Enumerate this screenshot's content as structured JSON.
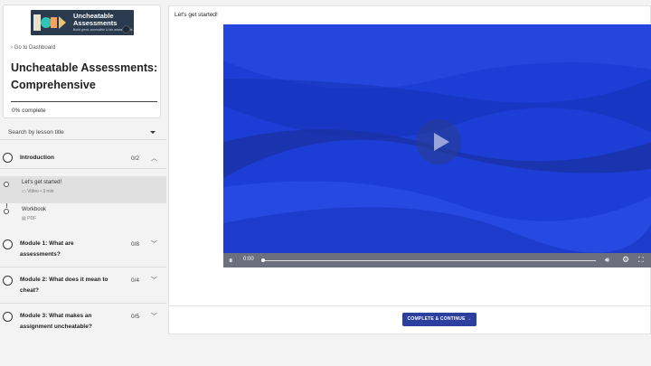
{
  "banner": {
    "title_line1": "Uncheatable",
    "title_line2": "Assessments",
    "subtitle": "Build great, accessible & fair assessments",
    "colors": {
      "bg": "#2a3a4f"
    }
  },
  "sidebar": {
    "back_label": "Go to Dashboard",
    "back_icon": "chevron-left-icon",
    "course_title": "Uncheatable Assessments: Comprehensive",
    "progress_text": "0% complete",
    "search_placeholder": "Search by lesson title",
    "sections": [
      {
        "title": "Introduction",
        "count": "0/2",
        "expanded": true,
        "lessons": [
          {
            "title": "Let's get started!",
            "meta": "Video • 3 min",
            "icon": "video-icon",
            "active": true
          },
          {
            "title": "Workbook",
            "meta": "PDF",
            "icon": "pdf-icon",
            "active": false
          }
        ]
      },
      {
        "title": "Module 1: What are assessments?",
        "title_line1": "Module 1: What are",
        "title_line2": "assessments?",
        "count": "0/8",
        "expanded": false
      },
      {
        "title": "Module 2: What does it mean to cheat?",
        "title_line1": "Module 2: What does it mean to",
        "title_line2": "cheat?",
        "count": "0/4",
        "expanded": false
      },
      {
        "title": "Module 3: What makes an assignment uncheatable?",
        "title_line1": "Module 3: What makes an",
        "title_line2": "assignment uncheatable?",
        "count": "0/5",
        "expanded": false
      }
    ]
  },
  "main": {
    "lesson_heading": "Let's get started!",
    "video": {
      "time": "0:00",
      "progress_percent": 0,
      "colors": {
        "bg": "#1d3ed6",
        "controls": "#6b6f7e"
      }
    },
    "cta_label": "COMPLETE & CONTINUE",
    "cta_arrow": "→",
    "colors": {
      "cta": "#2b3f9e"
    }
  }
}
